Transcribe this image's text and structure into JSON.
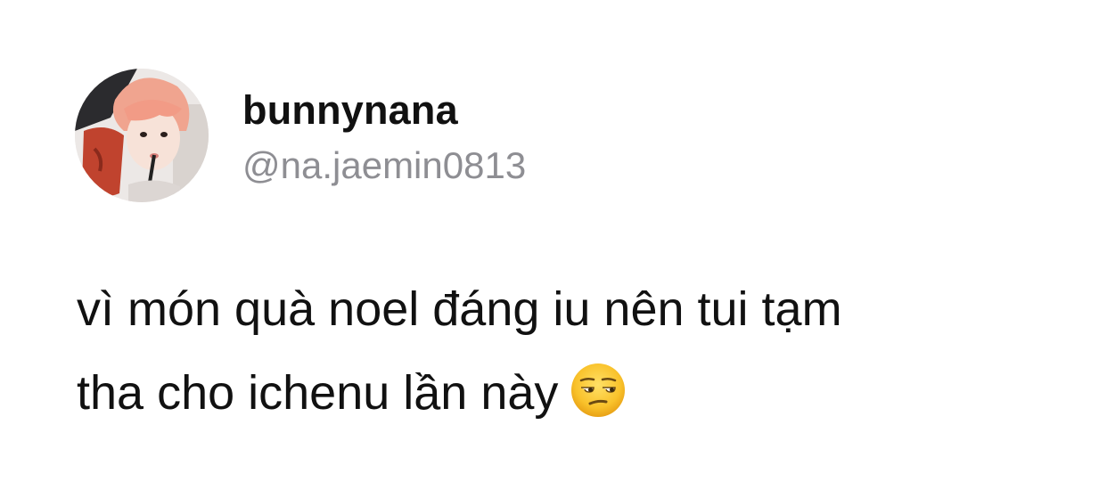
{
  "tweet": {
    "display_name": "bunnynana",
    "handle": "@na.jaemin0813",
    "text_line_1": "vì món quà noel đáng iu nên tui tạm",
    "text_line_2": "tha cho ichenu lần này",
    "emoji": "unamused-face-icon"
  },
  "colors": {
    "background": "#ffffff",
    "name_text": "#111111",
    "handle_text": "#8e8e93",
    "body_text": "#111111"
  }
}
